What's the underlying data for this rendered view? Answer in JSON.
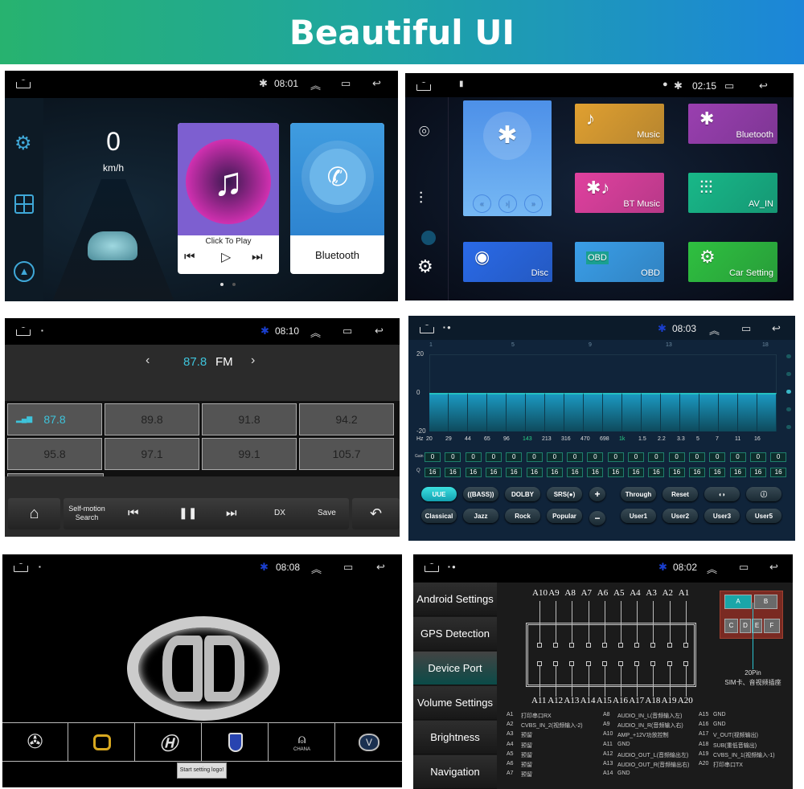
{
  "banner": {
    "title": "Beautiful UI",
    "colors": {
      "left": "#27b26f",
      "right": "#1c86d9"
    }
  },
  "screen1": {
    "time": "08:01",
    "speed": "0",
    "speed_unit": "km/h",
    "music_card": {
      "label": "Click To Play"
    },
    "bt_card": {
      "label": "Bluetooth"
    },
    "page_dots": 2,
    "active_page": 1,
    "sidebar_icons": [
      "gear-icon",
      "apps-grid-icon",
      "navigation-icon"
    ]
  },
  "screen2": {
    "time": "02:15",
    "sidebar_icons": [
      "location-pin-icon",
      "equalizer-icon",
      "gear-icon"
    ],
    "tiles": [
      {
        "label": "Music",
        "color": "#e0a030",
        "icon": "♪"
      },
      {
        "label": "Bluetooth",
        "color": "#9a3fb0",
        "icon": "✱"
      },
      {
        "label": "BT Music",
        "color": "#e0409e",
        "icon": "✱♪"
      },
      {
        "label": "AV_IN",
        "color": "#18b888",
        "icon": "⫶⫶⫶"
      },
      {
        "label": "Disc",
        "color": "#2a6ae8",
        "icon": "◉"
      },
      {
        "label": "OBD",
        "color": "#3a9ee8",
        "icon": "OBD"
      },
      {
        "label": "Car Setting",
        "color": "#2fc040",
        "icon": "⚙"
      }
    ]
  },
  "screen3": {
    "time": "08:10",
    "frequency": "87.8",
    "band": "FM",
    "presets": [
      "87.8",
      "89.8",
      "91.8",
      "94.2",
      "95.8",
      "97.1",
      "99.1",
      "105.7"
    ],
    "active_preset": 0,
    "bottom": {
      "search": "Self-motion Search",
      "dx": "DX",
      "save": "Save"
    },
    "accent": "#3ec3da"
  },
  "screen4": {
    "time": "08:03",
    "band_index_labels": [
      "1",
      "5",
      "9",
      "13",
      "18"
    ],
    "y_ticks": [
      "20",
      "0",
      "-20"
    ],
    "gain_range": [
      -20,
      20
    ],
    "hz_label": "Hz",
    "freqs": [
      "20",
      "29",
      "44",
      "65",
      "96",
      "143",
      "213",
      "316",
      "470",
      "698",
      "1k",
      "1.5",
      "2.2",
      "3.3",
      "5",
      "7",
      "11",
      "16"
    ],
    "highlight_freqs": [
      "143",
      "1k"
    ],
    "gain_label": "Gain",
    "q_label": "Q",
    "gains": [
      0,
      0,
      0,
      0,
      0,
      0,
      0,
      0,
      0,
      0,
      0,
      0,
      0,
      0,
      0,
      0,
      0,
      0
    ],
    "q": [
      16,
      16,
      16,
      16,
      16,
      16,
      16,
      16,
      16,
      16,
      16,
      16,
      16,
      16,
      16,
      16,
      16,
      16
    ],
    "row1": [
      "UUE",
      "((BASS))",
      "DOLBY",
      "SRS(●)",
      "+",
      "Through",
      "Reset",
      "◖◗",
      "ⓘ"
    ],
    "row2": [
      "Classical",
      "Jazz",
      "Rock",
      "Popular",
      "−",
      "User1",
      "User2",
      "User3",
      "User5"
    ]
  },
  "screen5": {
    "time": "08:08",
    "toast": "Start setting logo!",
    "logos": [
      "mercedes-logo",
      "golden-logo",
      "hyundai-logo",
      "shield-logo",
      "chana-logo",
      "changan-logo"
    ],
    "chana_text": "CHANA"
  },
  "screen6": {
    "time": "08:02",
    "menu": [
      "Android Settings",
      "GPS Detection",
      "Device Port",
      "Volume Settings",
      "Brightness",
      "Navigation"
    ],
    "active_menu": 2,
    "top_pins": [
      "A10",
      "A9",
      "A8",
      "A7",
      "A6",
      "A5",
      "A4",
      "A3",
      "A2",
      "A1"
    ],
    "bottom_pins": [
      "A11",
      "A12",
      "A13",
      "A14",
      "A15",
      "A16",
      "A17",
      "A18",
      "A19",
      "A20"
    ],
    "connector_slots": [
      "A",
      "B",
      "C",
      "D",
      "E",
      "F"
    ],
    "connector_caption": "20Pin",
    "connector_sub": "SIM卡、音视频插座",
    "pinout": [
      [
        "A1",
        "打印串口RX"
      ],
      [
        "A2",
        "CVBS_IN_2(视频输入-2)"
      ],
      [
        "A3",
        "预留"
      ],
      [
        "A4",
        "预留"
      ],
      [
        "A5",
        "预留"
      ],
      [
        "A6",
        "预留"
      ],
      [
        "A7",
        "预留"
      ],
      [
        "A8",
        "AUDIO_IN_L(音频输入左)"
      ],
      [
        "A9",
        "AUDIO_IN_R(音频输入右)"
      ],
      [
        "A10",
        "AMP_+12V功放控制"
      ],
      [
        "A11",
        "GND"
      ],
      [
        "A12",
        "AUDIO_OUT_L(音频输出左)"
      ],
      [
        "A13",
        "AUDIO_OUT_R(音频输出右)"
      ],
      [
        "A14",
        "GND"
      ],
      [
        "A15",
        "GND"
      ],
      [
        "A16",
        "GND"
      ],
      [
        "A17",
        "V_OUT(视频输出)"
      ],
      [
        "A18",
        "SUB(重低音输出)"
      ],
      [
        "A19",
        "CVBS_IN_1(视频输入-1)"
      ],
      [
        "A20",
        "打印串口TX"
      ]
    ]
  }
}
